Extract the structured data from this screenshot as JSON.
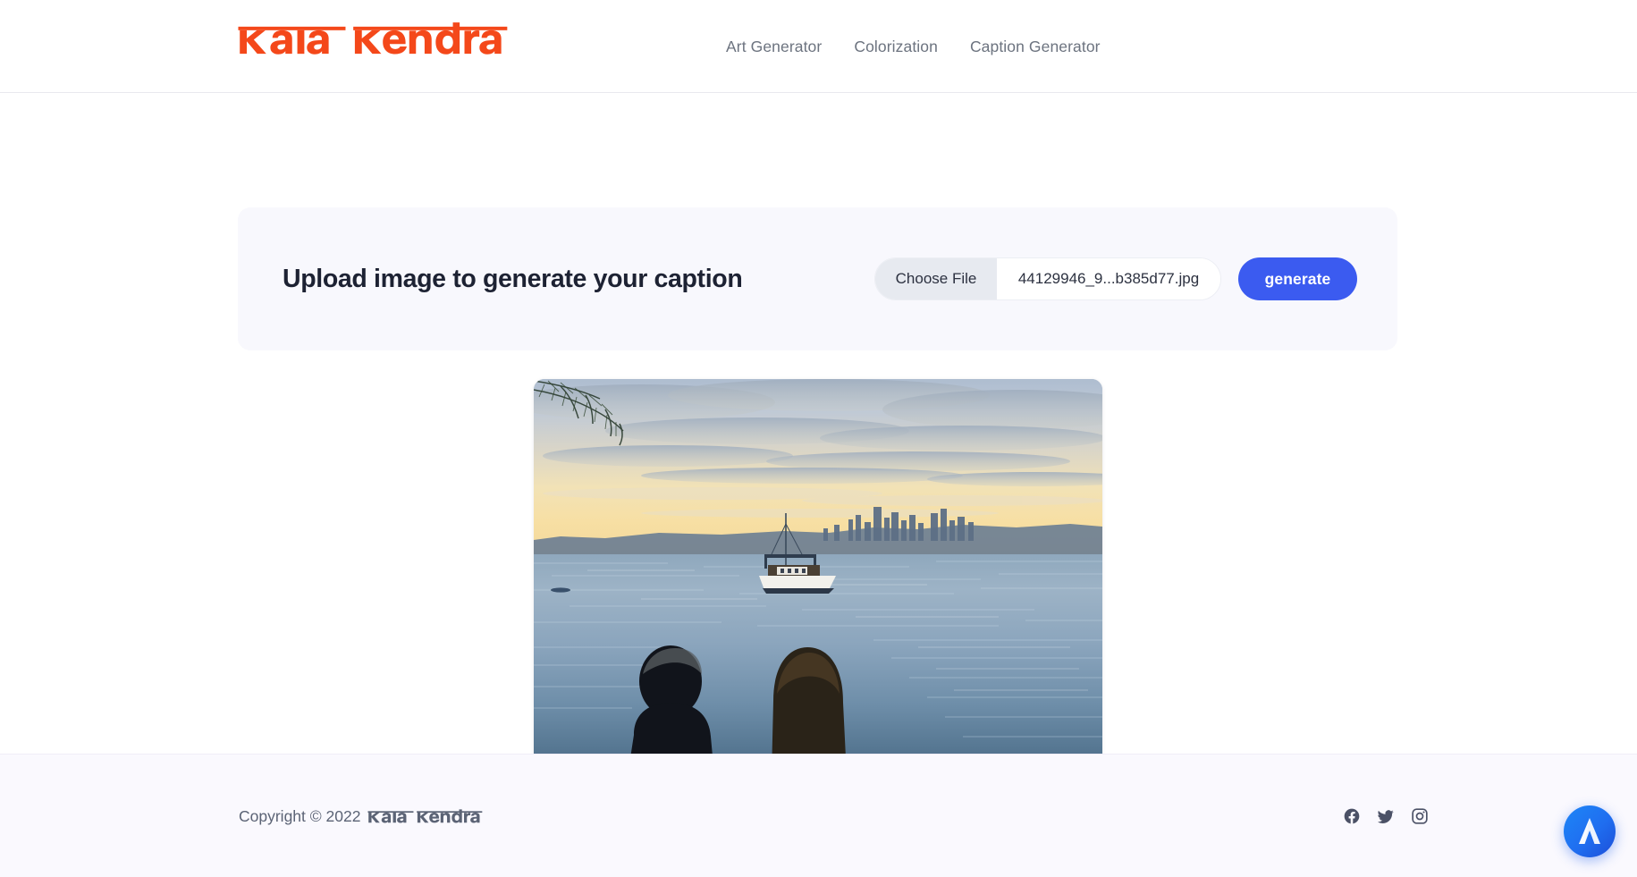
{
  "header": {
    "brand": {
      "name": "kala kendra",
      "color": "#f4481a"
    },
    "nav": [
      {
        "label": "Art Generator",
        "name": "nav-art-generator"
      },
      {
        "label": "Colorization",
        "name": "nav-colorization"
      },
      {
        "label": "Caption Generator",
        "name": "nav-caption-generator"
      }
    ]
  },
  "main": {
    "upload_card": {
      "title": "Upload image to generate your caption",
      "file_button_label": "Choose File",
      "file_name": "44129946_9...b385d77.jpg",
      "generate_label": "generate",
      "accent_color": "#3b5bf0",
      "card_background": "#f8f8fd"
    },
    "preview": {
      "alt": "Couple sitting on a bench watching a boat on the water at sunset with a city skyline on the horizon",
      "icon": "image-preview"
    }
  },
  "footer": {
    "copyright_text": "Copyright © 2022",
    "brand": "kala kendra",
    "social": [
      {
        "label": "Facebook",
        "icon": "facebook-icon"
      },
      {
        "label": "Twitter",
        "icon": "twitter-icon"
      },
      {
        "label": "Instagram",
        "icon": "instagram-icon"
      }
    ]
  },
  "fab": {
    "label": "Assistant",
    "icon": "assistant-a-icon",
    "color": "#1f7ef5"
  }
}
